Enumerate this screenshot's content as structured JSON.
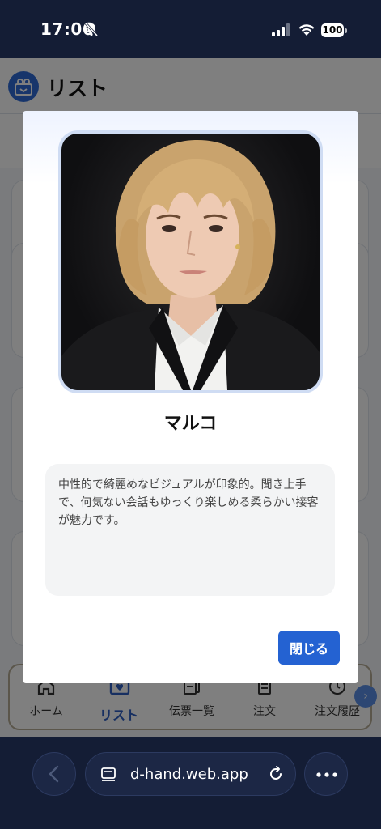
{
  "status_bar": {
    "time": "17:06",
    "battery": "100"
  },
  "app": {
    "title": "リスト",
    "nav": [
      {
        "label": "ホーム",
        "icon": "home-icon"
      },
      {
        "label": "リスト",
        "icon": "heart-list-icon",
        "active": true
      },
      {
        "label": "伝票一覧",
        "icon": "receipts-icon"
      },
      {
        "label": "注文",
        "icon": "order-icon"
      },
      {
        "label": "注文履歴",
        "icon": "history-icon"
      }
    ]
  },
  "modal": {
    "name": "マルコ",
    "description": "中性的で綺麗めなビジュアルが印象的。聞き上手で、何気ない会話もゆっくり楽しめる柔らかい接客が魅力です。",
    "close_label": "閉じる"
  },
  "browser": {
    "url": "d-hand.web.app"
  },
  "colors": {
    "accent": "#2462d2",
    "nav_active": "#2e5fc2",
    "chrome": "#141d35"
  }
}
